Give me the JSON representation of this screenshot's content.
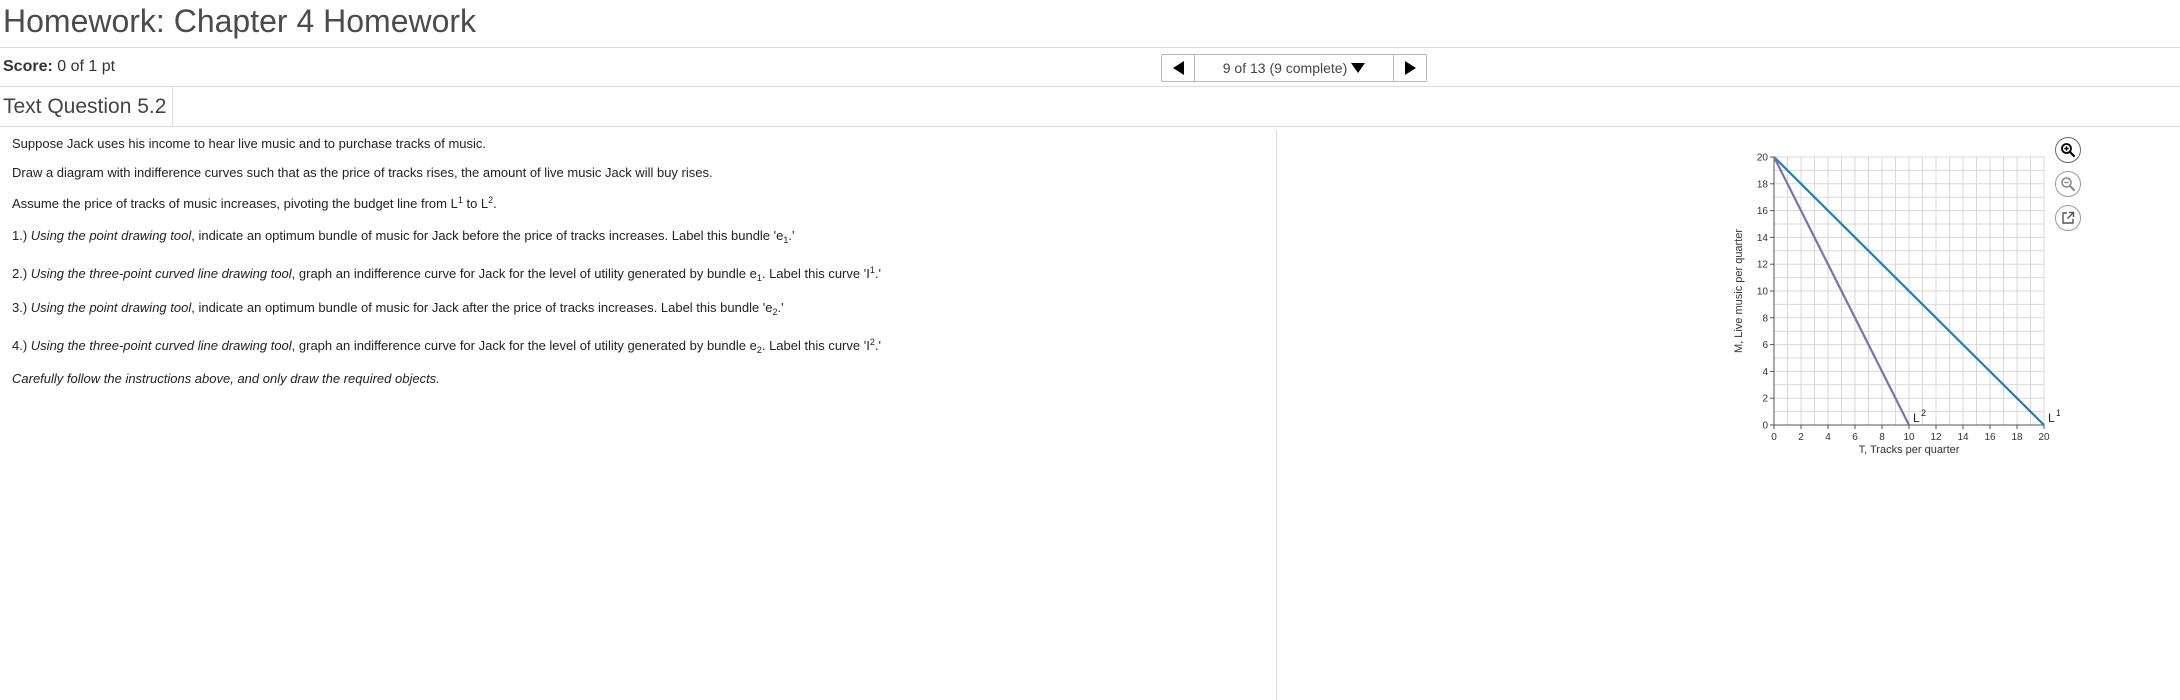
{
  "header": {
    "title": "Homework: Chapter 4 Homework"
  },
  "score": {
    "label": "Score:",
    "value": "0 of 1 pt"
  },
  "nav": {
    "position_text": "9 of 13 (9 complete)"
  },
  "question": {
    "title": "Text Question 5.2",
    "intro1": "Suppose Jack uses his income to hear live music and to purchase tracks of music.",
    "intro2": "Draw a diagram with indifference curves such that as the price of tracks rises, the amount of live music Jack will buy rises.",
    "intro3_a": "Assume the price of tracks of music increases, pivoting the budget line from L",
    "intro3_sup1": "1",
    "intro3_b": " to L",
    "intro3_sup2": "2",
    "intro3_c": ".",
    "step1_num": "1.) ",
    "step1_tool": "Using the point drawing tool",
    "step1_text": ", indicate an optimum bundle of music for Jack before the price of tracks increases.  Label this bundle 'e",
    "step1_sub": "1",
    "step1_end": ".'",
    "step2_num": "2.) ",
    "step2_tool": "Using the three-point curved line drawing tool",
    "step2_text": ", graph an indifference curve for Jack for the level of utility generated by bundle e",
    "step2_sub": "1",
    "step2_mid": ".  Label this curve 'I",
    "step2_sup": "1",
    "step2_end": ".'",
    "step3_num": "3.) ",
    "step3_tool": "Using the point drawing tool",
    "step3_text": ", indicate an optimum bundle of music for Jack after the price of tracks increases.  Label this bundle 'e",
    "step3_sub": "2",
    "step3_end": ".'",
    "step4_num": "4.) ",
    "step4_tool": "Using the three-point curved line drawing tool",
    "step4_text": ", graph an indifference curve for Jack for the level of utility generated by bundle e",
    "step4_sub": "2",
    "step4_mid": ".  Label this curve 'I",
    "step4_sup": "2",
    "step4_end": ".'",
    "note": "Carefully follow the instructions above, and only draw the required objects."
  },
  "graph": {
    "xlabel": "T, Tracks per quarter",
    "ylabel": "M, Live music per quarter",
    "x_ticks": [
      "0",
      "2",
      "4",
      "6",
      "8",
      "10",
      "12",
      "14",
      "16",
      "18",
      "20"
    ],
    "y_ticks": [
      "0",
      "2",
      "4",
      "6",
      "8",
      "10",
      "12",
      "14",
      "16",
      "18",
      "20"
    ],
    "xlim": [
      0,
      20
    ],
    "ylim": [
      0,
      20
    ],
    "lines": [
      {
        "name": "L",
        "sup": "1",
        "x": [
          0,
          20
        ],
        "y": [
          20,
          0
        ],
        "color": "#1f7fb8"
      },
      {
        "name": "L",
        "sup": "2",
        "x": [
          0,
          10
        ],
        "y": [
          20,
          0
        ],
        "color": "#7b70b5"
      }
    ],
    "grid_color": "#d9d9d9"
  },
  "tools": {
    "zoom_in_icon": "zoom-in-icon",
    "zoom_out_icon": "zoom-out-icon",
    "popout_icon": "popout-icon"
  }
}
